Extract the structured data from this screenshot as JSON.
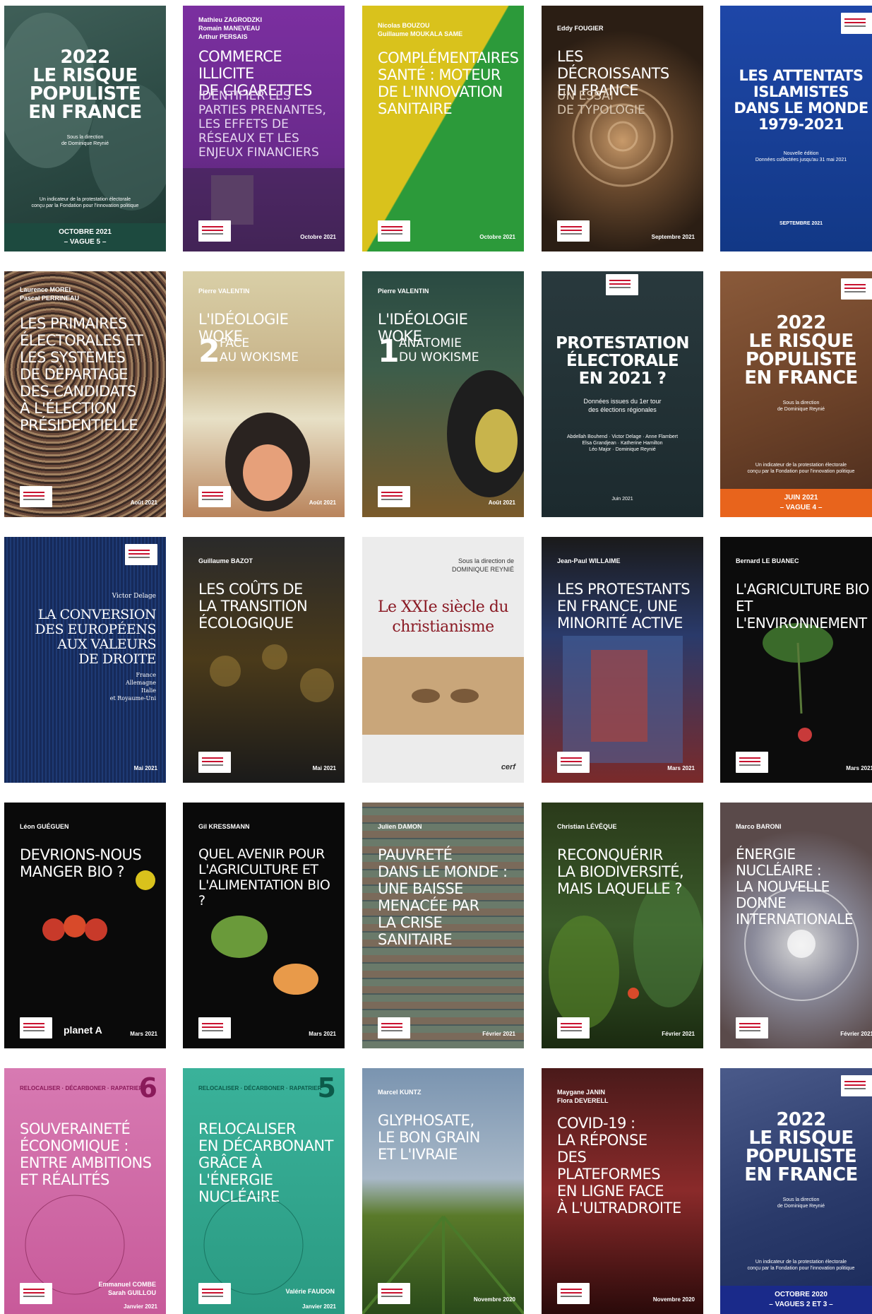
{
  "covers": [
    {
      "big": "2022\nLE RISQUE\nPOPULISTE\nEN FRANCE",
      "direction": "Sous la direction\nde Dominique Reynié",
      "note": "Un indicateur de la protestation électorale\nconçu par la Fondation pour l'innovation politique",
      "band": "OCTOBRE 2021\n– VAGUE 5 –"
    },
    {
      "author": "Mathieu ZAGRODZKI\nRomain MANEVEAU\nArthur PERSAIS",
      "title": "COMMERCE ILLICITE\nDE CIGARETTES",
      "subtitle": "IDENTIFIER LES\nPARTIES PRENANTES,\nLES EFFETS DE\nRÉSEAUX ET LES\nENJEUX FINANCIERS",
      "date": "Octobre 2021"
    },
    {
      "author": "Nicolas BOUZOU\nGuillaume MOUKALA SAME",
      "title": "COMPLÉMENTAIRES\nSANTÉ : MOTEUR\nDE L'INNOVATION\nSANITAIRE",
      "date": "Octobre 2021"
    },
    {
      "author": "Eddy FOUGIER",
      "title": "LES DÉCROISSANTS\nEN FRANCE",
      "subtitle": "UN ESSAI\nDE TYPOLOGIE",
      "date": "Septembre 2021"
    },
    {
      "big": "LES ATTENTATS\nISLAMISTES\nDANS LE MONDE\n1979-2021",
      "note": "Nouvelle édition\nDonnées collectées jusqu'au 31 mai 2021",
      "date": "SEPTEMBRE 2021"
    },
    {
      "author": "Laurence MOREL\nPascal PERRINEAU",
      "title": "LES PRIMAIRES\nÉLECTORALES ET\nLES SYSTÈMES\nDE DÉPARTAGE\nDES CANDIDATS\nÀ L'ÉLECTION\nPRÉSIDENTIELLE",
      "date": "Août 2021"
    },
    {
      "author": "Pierre VALENTIN",
      "title": "L'IDÉOLOGIE WOKE",
      "number": "2",
      "subtitle": "FACE\nAU WOKISME",
      "date": "Août 2021"
    },
    {
      "author": "Pierre VALENTIN",
      "title": "L'IDÉOLOGIE WOKE",
      "number": "1",
      "subtitle": "ANATOMIE\nDU WOKISME",
      "date": "Août 2021"
    },
    {
      "big": "PROTESTATION\nÉLECTORALE\nEN 2021 ?",
      "note": "Données issues du 1er tour\ndes élections régionales",
      "names": "Abdellah Bouhend · Victor Delage · Anne Flambert\nElsa Grandjean · Katherine Hamilton\nLéo Major · Dominique Reynié",
      "date": "Juin 2021"
    },
    {
      "big": "2022\nLE RISQUE\nPOPULISTE\nEN FRANCE",
      "direction": "Sous la direction\nde Dominique Reynié",
      "note": "Un indicateur de la protestation électorale\nconçu par la Fondation pour l'innovation politique",
      "band": "JUIN 2021\n– VAGUE 4 –"
    },
    {
      "author": "Victor Delage",
      "title": "LA CONVERSION\nDES EUROPÉENS\nAUX VALEURS\nDE DROITE",
      "subtitle": "France\nAllemagne\nItalie\net Royaume-Uni",
      "date": "Mai 2021"
    },
    {
      "author": "Guillaume BAZOT",
      "title": "LES COÛTS DE\nLA TRANSITION\nÉCOLOGIQUE",
      "date": "Mai 2021"
    },
    {
      "author": "Sous la direction de\nDOMINIQUE REYNIÉ",
      "title": "Le XXIe siècle du\nchristianisme",
      "date": "cerf"
    },
    {
      "author": "Jean-Paul WILLAIME",
      "title": "LES PROTESTANTS\nEN FRANCE, UNE\nMINORITÉ ACTIVE",
      "date": "Mars 2021"
    },
    {
      "author": "Bernard LE BUANEC",
      "title": "L'AGRICULTURE BIO\nET L'ENVIRONNEMENT",
      "date": "Mars 2021"
    },
    {
      "author": "Léon GUÉGUEN",
      "title": "DEVRIONS-NOUS\nMANGER BIO ?",
      "logo2": "planet A",
      "date": "Mars 2021"
    },
    {
      "author": "Gil KRESSMANN",
      "title": "QUEL AVENIR POUR\nL'AGRICULTURE ET\nL'ALIMENTATION BIO ?",
      "date": "Mars 2021"
    },
    {
      "author": "Julien DAMON",
      "title": "PAUVRETÉ\nDANS LE MONDE :\nUNE BAISSE\nMENACÉE PAR\nLA CRISE SANITAIRE",
      "date": "Février 2021"
    },
    {
      "author": "Christian LÉVÊQUE",
      "title": "RECONQUÉRIR\nLA BIODIVERSITÉ,\nMAIS LAQUELLE ?",
      "date": "Février 2021"
    },
    {
      "author": "Marco BARONI",
      "title": "ÉNERGIE NUCLÉAIRE :\nLA NOUVELLE DONNE\nINTERNATIONALE",
      "date": "Février 2021"
    },
    {
      "series": "RELOCALISER · DÉCARBONER · RAPATRIER",
      "number": "6",
      "title": "SOUVERAINETÉ\nÉCONOMIQUE :\nENTRE AMBITIONS\nET RÉALITÉS",
      "authors_bottom": "Emmanuel COMBE\nSarah GUILLOU",
      "date": "Janvier 2021"
    },
    {
      "series": "RELOCALISER · DÉCARBONER · RAPATRIER",
      "number": "5",
      "title": "RELOCALISER\nEN DÉCARBONANT\nGRÂCE À L'ÉNERGIE\nNUCLÉAIRE",
      "authors_bottom": "Valérie FAUDON",
      "date": "Janvier 2021"
    },
    {
      "author": "Marcel KUNTZ",
      "title": "GLYPHOSATE,\nLE BON GRAIN\nET L'IVRAIE",
      "date": "Novembre 2020"
    },
    {
      "author": "Maygane JANIN\nFlora DEVERELL",
      "title": "COVID-19 :\nLA RÉPONSE\nDES PLATEFORMES\nEN LIGNE FACE\nÀ L'ULTRADROITE",
      "date": "Novembre 2020"
    },
    {
      "big": "2022\nLE RISQUE\nPOPULISTE\nEN FRANCE",
      "direction": "Sous la direction\nde Dominique Reynié",
      "note": "Un indicateur de la protestation électorale\nconçu par la Fondation pour l'innovation politique",
      "band": "OCTOBRE 2020\n– VAGUES 2 ET 3 –"
    }
  ]
}
